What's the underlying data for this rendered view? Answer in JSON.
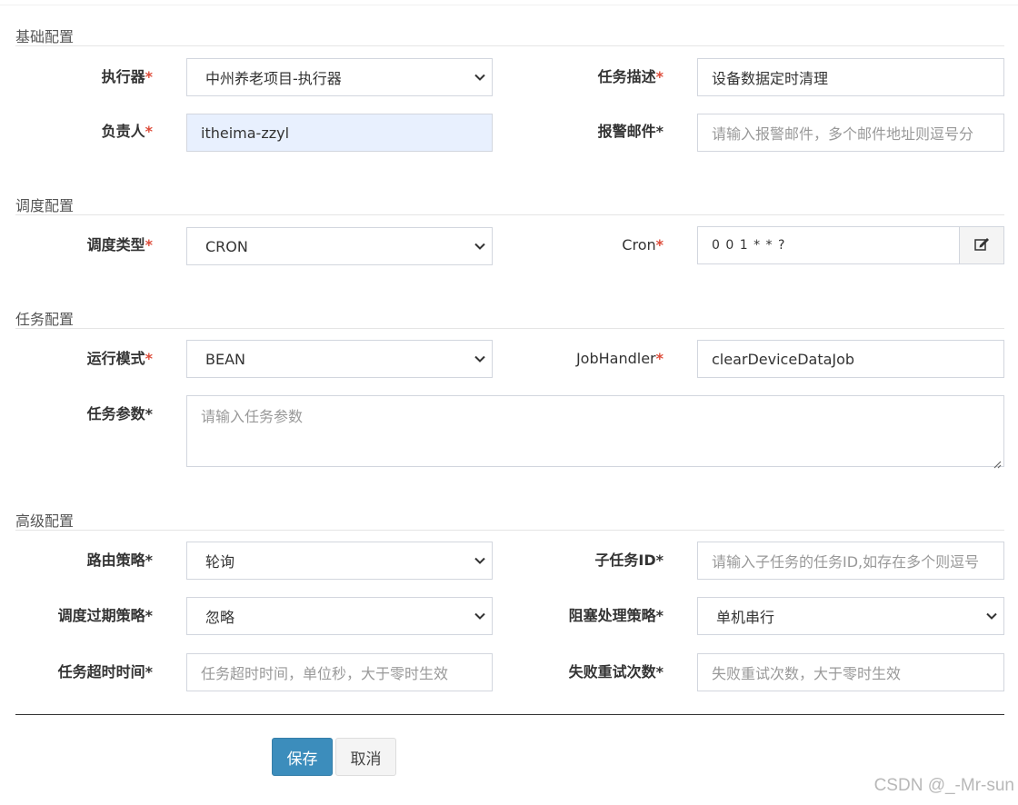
{
  "sections": {
    "basic": "基础配置",
    "schedule": "调度配置",
    "task": "任务配置",
    "advanced": "高级配置"
  },
  "executor": {
    "label": "执行器",
    "value": "中州养老项目-执行器"
  },
  "job_desc": {
    "label": "任务描述",
    "value": "设备数据定时清理"
  },
  "author": {
    "label": "负责人",
    "value": "itheima-zzyl"
  },
  "alarm_email": {
    "label": "报警邮件",
    "placeholder": "请输入报警邮件，多个邮件地址则逗号分"
  },
  "schedule_type": {
    "label": "调度类型",
    "value": "CRON"
  },
  "cron": {
    "label": "Cron",
    "value": "0 0 1 * * ?"
  },
  "glue_type": {
    "label": "运行模式",
    "value": "BEAN"
  },
  "job_handler": {
    "label": "JobHandler",
    "value": "clearDeviceDataJob"
  },
  "job_param": {
    "label": "任务参数",
    "placeholder": "请输入任务参数"
  },
  "route_strategy": {
    "label": "路由策略",
    "value": "轮询"
  },
  "child_job_id": {
    "label": "子任务ID",
    "placeholder": "请输入子任务的任务ID,如存在多个则逗号"
  },
  "misfire_strategy": {
    "label": "调度过期策略",
    "value": "忽略"
  },
  "block_strategy": {
    "label": "阻塞处理策略",
    "value": "单机串行"
  },
  "timeout": {
    "label": "任务超时时间",
    "placeholder": "任务超时时间，单位秒，大于零时生效"
  },
  "fail_retry": {
    "label": "失败重试次数",
    "placeholder": "失败重试次数，大于零时生效"
  },
  "required_mark": "*",
  "buttons": {
    "save": "保存",
    "cancel": "取消"
  },
  "watermark": "CSDN @_-Mr-sun",
  "colors": {
    "primary": "#3c8dbc",
    "required": "#dd4b39",
    "autofill": "#e8f0fe"
  }
}
